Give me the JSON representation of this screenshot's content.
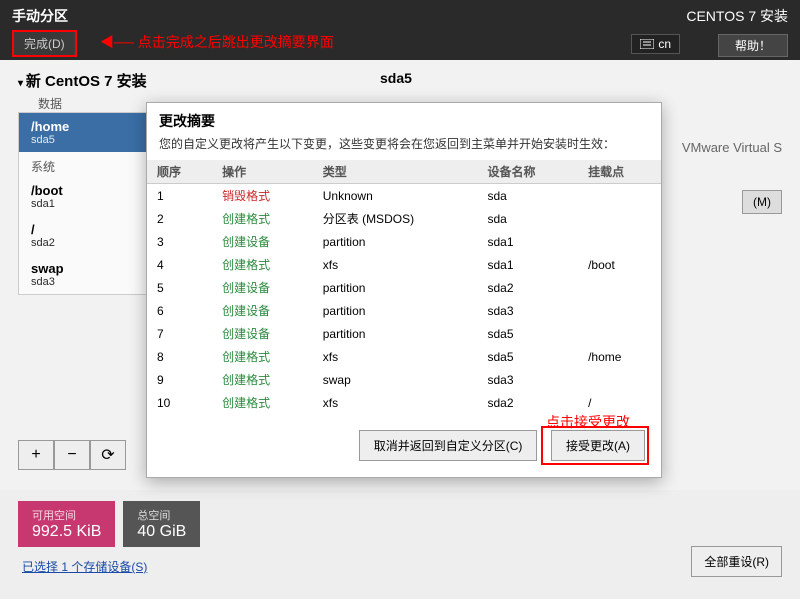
{
  "header": {
    "title": "手动分区",
    "done_button": "完成(D)",
    "installer_title": "CENTOS 7 安装",
    "keyboard": "cn",
    "help": "帮助！",
    "annotation": "点击完成之后跳出更改摘要界面"
  },
  "sidebar": {
    "install_label": "新 CentOS 7 安装",
    "data_label": "数据",
    "system_label": "系统",
    "partitions": [
      {
        "mount": "/home",
        "dev": "sda5",
        "selected": true
      },
      {
        "mount": "/boot",
        "dev": "sda1",
        "selected": false
      },
      {
        "mount": "/",
        "dev": "sda2",
        "selected": false
      },
      {
        "mount": "swap",
        "dev": "sda3",
        "selected": false
      }
    ],
    "buttons": {
      "add": "+",
      "remove": "−",
      "refresh": "⟳"
    }
  },
  "right_panel": {
    "device_label": "sda5",
    "device_desc": "VMware Virtual S",
    "modify_button": "(M)"
  },
  "modal": {
    "title": "更改摘要",
    "description": "您的自定义更改将产生以下变更，这些变更将会在您返回到主菜单并开始安装时生效：",
    "columns": {
      "order": "顺序",
      "operation": "操作",
      "type": "类型",
      "device_name": "设备名称",
      "mount_point": "挂载点"
    },
    "rows": [
      {
        "order": "1",
        "op": "销毁格式",
        "op_class": "destroy",
        "type": "Unknown",
        "dev": "sda",
        "mount": ""
      },
      {
        "order": "2",
        "op": "创建格式",
        "op_class": "create",
        "type": "分区表 (MSDOS)",
        "dev": "sda",
        "mount": ""
      },
      {
        "order": "3",
        "op": "创建设备",
        "op_class": "create",
        "type": "partition",
        "dev": "sda1",
        "mount": ""
      },
      {
        "order": "4",
        "op": "创建格式",
        "op_class": "create",
        "type": "xfs",
        "dev": "sda1",
        "mount": "/boot"
      },
      {
        "order": "5",
        "op": "创建设备",
        "op_class": "create",
        "type": "partition",
        "dev": "sda2",
        "mount": ""
      },
      {
        "order": "6",
        "op": "创建设备",
        "op_class": "create",
        "type": "partition",
        "dev": "sda3",
        "mount": ""
      },
      {
        "order": "7",
        "op": "创建设备",
        "op_class": "create",
        "type": "partition",
        "dev": "sda5",
        "mount": ""
      },
      {
        "order": "8",
        "op": "创建格式",
        "op_class": "create",
        "type": "xfs",
        "dev": "sda5",
        "mount": "/home"
      },
      {
        "order": "9",
        "op": "创建格式",
        "op_class": "create",
        "type": "swap",
        "dev": "sda3",
        "mount": ""
      },
      {
        "order": "10",
        "op": "创建格式",
        "op_class": "create",
        "type": "xfs",
        "dev": "sda2",
        "mount": "/"
      }
    ],
    "cancel_button": "取消并返回到自定义分区(C)",
    "accept_button": "接受更改(A)",
    "annotation": "点击接受更改"
  },
  "bottom": {
    "avail_label": "可用空间",
    "avail_value": "992.5 KiB",
    "total_label": "总空间",
    "total_value": "40 GiB",
    "selected_link": "已选择 1 个存储设备(S)",
    "reset_button": "全部重设(R)"
  }
}
